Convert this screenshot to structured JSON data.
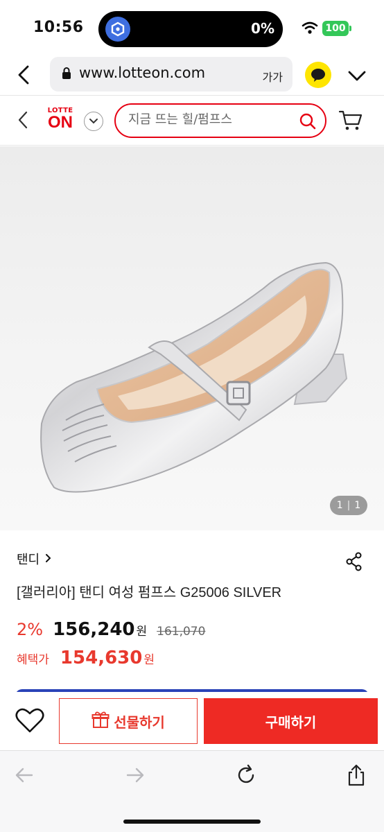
{
  "status_bar": {
    "time": "10:56",
    "island_percent": "0%",
    "battery": "100"
  },
  "browser": {
    "url": "www.lotteon.com",
    "text_size_label": "가가"
  },
  "site_header": {
    "logo_top": "LOTTE",
    "logo_main": "ON",
    "search_placeholder": "지금 뜨는 힐/펌프스"
  },
  "gallery": {
    "current": "1",
    "total": "1"
  },
  "product": {
    "brand": "탠디",
    "title": "[갤러리아] 탠디 여성 펌프스 G25006 SILVER",
    "discount": "2%",
    "price": "156,240",
    "currency": "원",
    "original_price": "161,070",
    "benefit_label": "혜택가",
    "benefit_price": "154,630",
    "benefit_currency": "원"
  },
  "actions": {
    "gift_label": "선물하기",
    "buy_label": "구매하기"
  },
  "colors": {
    "brand_red": "#e60012",
    "sale_red": "#e8392e",
    "buy_button": "#ee2a24",
    "accent_blue": "#2a43b8",
    "battery_green": "#34c759",
    "kakao_yellow": "#fee500"
  },
  "icons": [
    "back-chevron-icon",
    "lock-icon",
    "kakao-talk-icon",
    "chevron-down-icon",
    "search-icon",
    "cart-icon",
    "share-icon",
    "heart-icon",
    "gift-icon",
    "arrow-left-icon",
    "arrow-right-icon",
    "reload-icon",
    "share-upload-icon",
    "wifi-icon"
  ]
}
